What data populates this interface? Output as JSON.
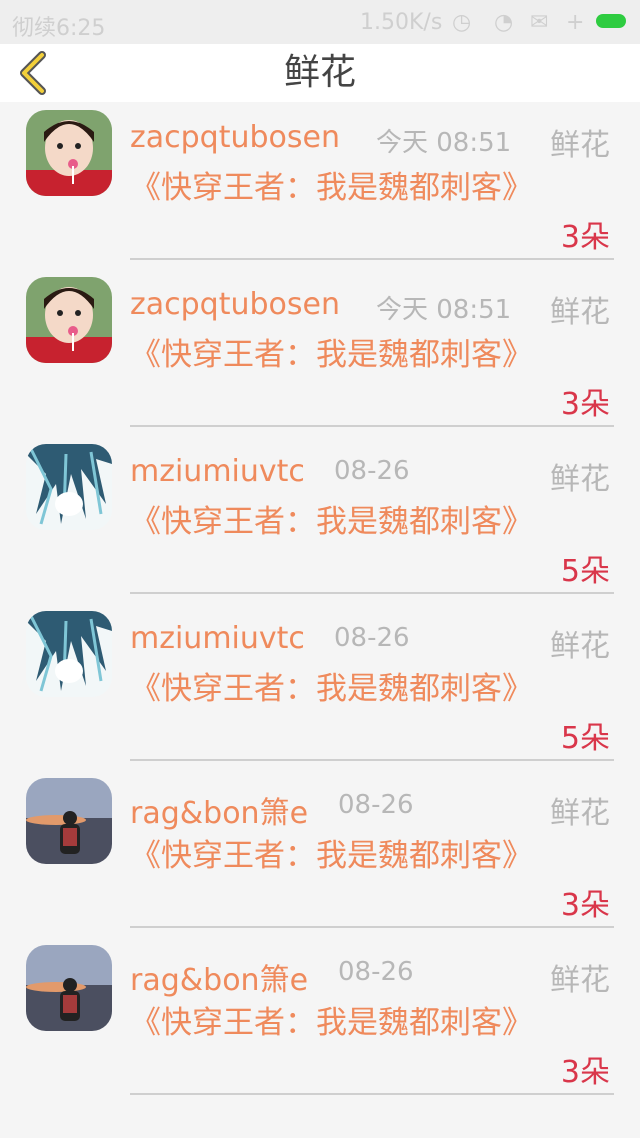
{
  "status_bar": {
    "carrier": "彻续6:25",
    "speed": "1.50K/s"
  },
  "header": {
    "title": "鲜花",
    "back_icon": "chevron-left-icon"
  },
  "colors": {
    "accent": "#ef8a5c",
    "count": "#d9364a",
    "muted": "#b7b7b7"
  },
  "items": [
    {
      "user": "zacpqtubosen",
      "time": "今天 08:51",
      "type": "鲜花",
      "book": "《快穿王者：我是魏都刺客》",
      "count": "3朵",
      "avatar": "girl"
    },
    {
      "user": "zacpqtubosen",
      "time": "今天 08:51",
      "type": "鲜花",
      "book": "《快穿王者：我是魏都刺客》",
      "count": "3朵",
      "avatar": "girl"
    },
    {
      "user": "mziumiuvtc",
      "time": "08-26",
      "type": "鲜花",
      "book": "《快穿王者：我是魏都刺客》",
      "count": "5朵",
      "avatar": "anime"
    },
    {
      "user": "mziumiuvtc",
      "time": "08-26",
      "type": "鲜花",
      "book": "《快穿王者：我是魏都刺客》",
      "count": "5朵",
      "avatar": "anime"
    },
    {
      "user": "rag&bon箫e",
      "time": "08-26",
      "type": "鲜花",
      "book": "《快穿王者：我是魏都刺客》",
      "count": "3朵",
      "avatar": "sunset"
    },
    {
      "user": "rag&bon箫e",
      "time": "08-26",
      "type": "鲜花",
      "book": "《快穿王者：我是魏都刺客》",
      "count": "3朵",
      "avatar": "sunset"
    }
  ]
}
